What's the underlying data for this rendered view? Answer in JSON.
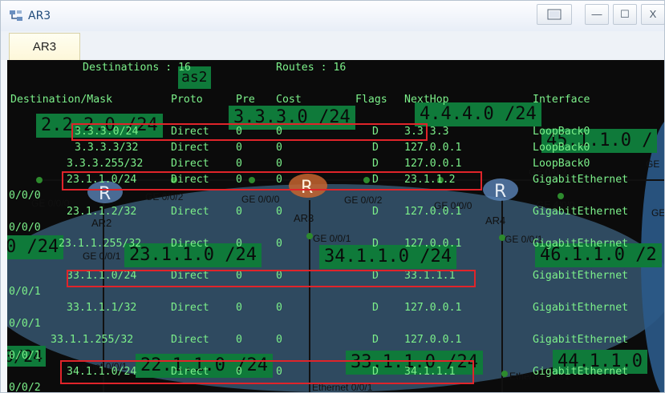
{
  "window": {
    "title": "AR3",
    "tab_label": "AR3",
    "close_glyph": "X",
    "min_glyph": "—",
    "max_glyph": "☐"
  },
  "terminal": {
    "summary_destinations": "Destinations : 16",
    "summary_routes": "Routes : 16",
    "header": {
      "dest": "Destination/Mask",
      "proto": "Proto",
      "pre": "Pre",
      "cost": "Cost",
      "flags": "Flags",
      "nexthop": "NextHop",
      "iface": "Interface"
    },
    "rows": [
      {
        "dest": "3.3.3.0/24",
        "proto": "Direct",
        "pre": "0",
        "cost": "0",
        "flag": "D",
        "nexthop": "3.3.3.3",
        "iface": "LoopBack0"
      },
      {
        "dest": "3.3.3.3/32",
        "proto": "Direct",
        "pre": "0",
        "cost": "0",
        "flag": "D",
        "nexthop": "127.0.0.1",
        "iface": "LoopBack0"
      },
      {
        "dest": "3.3.3.255/32",
        "proto": "Direct",
        "pre": "0",
        "cost": "0",
        "flag": "D",
        "nexthop": "127.0.0.1",
        "iface": "LoopBack0"
      },
      {
        "dest": "23.1.1.0/24",
        "proto": "Direct",
        "pre": "0",
        "cost": "0",
        "flag": "D",
        "nexthop": "23.1.1.2",
        "iface": "GigabitEthernet"
      },
      {
        "dest": "23.1.1.2/32",
        "proto": "Direct",
        "pre": "0",
        "cost": "0",
        "flag": "D",
        "nexthop": "127.0.0.1",
        "iface": "GigabitEthernet"
      },
      {
        "dest": "23.1.1.255/32",
        "proto": "Direct",
        "pre": "0",
        "cost": "0",
        "flag": "D",
        "nexthop": "127.0.0.1",
        "iface": "GigabitEthernet"
      },
      {
        "dest": "33.1.1.0/24",
        "proto": "Direct",
        "pre": "0",
        "cost": "0",
        "flag": "D",
        "nexthop": "33.1.1.1",
        "iface": "GigabitEthernet"
      },
      {
        "dest": "33.1.1.1/32",
        "proto": "Direct",
        "pre": "0",
        "cost": "0",
        "flag": "D",
        "nexthop": "127.0.0.1",
        "iface": "GigabitEthernet"
      },
      {
        "dest": "33.1.1.255/32",
        "proto": "Direct",
        "pre": "0",
        "cost": "0",
        "flag": "D",
        "nexthop": "127.0.0.1",
        "iface": "GigabitEthernet"
      },
      {
        "dest": "34.1.1.0/24",
        "proto": "Direct",
        "pre": "0",
        "cost": "0",
        "flag": "D",
        "nexthop": "34.1.1.1",
        "iface": "GigabitEthernet"
      }
    ],
    "wrap_lines": [
      "0/0/0",
      "0/0/0",
      "0/0/1",
      "0/0/1",
      "0/0/1",
      "0/0/2"
    ]
  },
  "topology": {
    "devices": [
      "AR2",
      "AR3",
      "AR4"
    ],
    "router_glyph": "R",
    "as_label": "as2",
    "subnet_labels": [
      "2.2.2.0 /24",
      "3.3.3.0 /24",
      "4.4.4.0 /24",
      "45.1.1.0 /",
      "23.1.1.0 /24",
      "34.1.1.0 /24",
      "46.1.1.0 /2",
      "22.1.1.0 /24",
      "33.1.1.0 /24",
      "44.1.1.0",
      "0 /24",
      "0/24"
    ],
    "iface_labels": [
      "GE 0/0/0",
      "GE 0/0/2",
      "GE 0/0/0",
      "GE 0/0/2",
      "GE 0/0/0",
      "GE 4/0/0",
      "GE 0/0/2",
      "GE 0/0/1",
      "GE 0/0/1",
      "GE 0/0/1",
      "Ethernet 0/0/1",
      "Ethernet 0/0/1",
      "Ethernet 0/0/1",
      "GE",
      "GE"
    ],
    "colors": {
      "terminal_text": "#7cf08a",
      "label_bg": "#0f7a3a",
      "highlight": "#e0242a",
      "cloud": "#2b5a8a"
    }
  }
}
